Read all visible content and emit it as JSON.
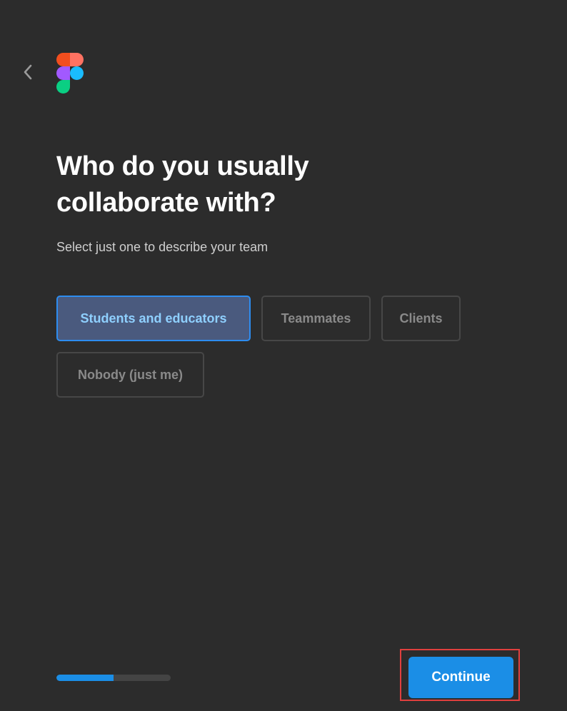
{
  "header": {
    "back_icon": "chevron-left-icon",
    "logo_icon": "figma-logo-icon"
  },
  "main": {
    "title": "Who do you usually collaborate with?",
    "subtitle": "Select just one to describe your team",
    "options": [
      {
        "label": "Students and educators",
        "selected": true
      },
      {
        "label": "Teammates",
        "selected": false
      },
      {
        "label": "Clients",
        "selected": false
      },
      {
        "label": "Nobody (just me)",
        "selected": false
      }
    ]
  },
  "footer": {
    "progress_fraction": 0.5,
    "continue_label": "Continue"
  },
  "colors": {
    "background": "#2c2c2c",
    "accent": "#1b8ee6",
    "selected_fill": "#4a5a7e",
    "selected_border": "#2d8df0",
    "selected_text": "#8fd0ff",
    "highlight_box": "#e0403e"
  }
}
